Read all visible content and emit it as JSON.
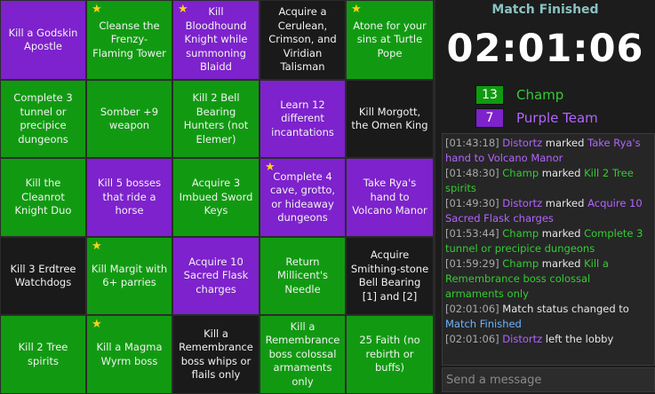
{
  "board": {
    "cells": [
      {
        "text": "Kill a Godskin Apostle",
        "color": "purple",
        "star": false
      },
      {
        "text": "Cleanse the Frenzy-Flaming Tower",
        "color": "green",
        "star": true
      },
      {
        "text": "Kill Bloodhound Knight while summoning Blaidd",
        "color": "purple",
        "star": true
      },
      {
        "text": "Acquire a Cerulean, Crimson, and Viridian Talisman",
        "color": "dark",
        "star": false
      },
      {
        "text": "Atone for your sins at Turtle Pope",
        "color": "green",
        "star": true
      },
      {
        "text": "Complete 3 tunnel or precipice dungeons",
        "color": "green",
        "star": false
      },
      {
        "text": "Somber +9 weapon",
        "color": "green",
        "star": false
      },
      {
        "text": "Kill 2 Bell Bearing Hunters (not Elemer)",
        "color": "green",
        "star": false
      },
      {
        "text": "Learn 12 different incantations",
        "color": "purple",
        "star": false
      },
      {
        "text": "Kill Morgott, the Omen King",
        "color": "dark",
        "star": false
      },
      {
        "text": "Kill the Cleanrot Knight Duo",
        "color": "green",
        "star": false
      },
      {
        "text": "Kill 5 bosses that ride a horse",
        "color": "purple",
        "star": false
      },
      {
        "text": "Acquire 3 Imbued Sword Keys",
        "color": "green",
        "star": false
      },
      {
        "text": "Complete 4 cave, grotto, or hideaway dungeons",
        "color": "purple",
        "star": true
      },
      {
        "text": "Take Rya's hand to Volcano Manor",
        "color": "purple",
        "star": false
      },
      {
        "text": "Kill 3 Erdtree Watchdogs",
        "color": "dark",
        "star": false
      },
      {
        "text": "Kill Margit with 6+ parries",
        "color": "green",
        "star": true
      },
      {
        "text": "Acquire 10 Sacred Flask charges",
        "color": "purple",
        "star": false
      },
      {
        "text": "Return Millicent's Needle",
        "color": "green",
        "star": false
      },
      {
        "text": "Acquire Smithing-stone Bell Bearing [1] and [2]",
        "color": "dark",
        "star": false
      },
      {
        "text": "Kill 2 Tree spirits",
        "color": "green",
        "star": false
      },
      {
        "text": "Kill a Magma Wyrm boss",
        "color": "green",
        "star": true
      },
      {
        "text": "Kill a Remembrance boss whips or flails only",
        "color": "dark",
        "star": false
      },
      {
        "text": "Kill a Remembrance boss colossal armaments only",
        "color": "green",
        "star": false
      },
      {
        "text": "25 Faith (no rebirth or buffs)",
        "color": "green",
        "star": false
      }
    ]
  },
  "colors": {
    "green": "#119a11",
    "purple": "#7d22cc",
    "dark": "#1a1a1a",
    "star": "#ffd21a"
  },
  "status": "Match Finished",
  "timer": "02:01:06",
  "teams": [
    {
      "count": "13",
      "name": "Champ",
      "color": "green"
    },
    {
      "count": "7",
      "name": "Purple Team",
      "color": "purple"
    }
  ],
  "log": [
    [
      {
        "c": "ts",
        "t": "[01:43:18] "
      },
      {
        "c": "p-purple",
        "t": "Distortz"
      },
      {
        "c": "txt",
        "t": " marked "
      },
      {
        "c": "p-purple",
        "t": "Take Rya's hand to Volcano Manor"
      }
    ],
    [
      {
        "c": "ts",
        "t": "[01:48:30] "
      },
      {
        "c": "p-green",
        "t": "Champ"
      },
      {
        "c": "txt",
        "t": " marked "
      },
      {
        "c": "p-green",
        "t": "Kill 2 Tree spirits"
      }
    ],
    [
      {
        "c": "ts",
        "t": "[01:49:30] "
      },
      {
        "c": "p-purple",
        "t": "Distortz"
      },
      {
        "c": "txt",
        "t": " marked "
      },
      {
        "c": "p-purple",
        "t": "Acquire 10 Sacred Flask charges"
      }
    ],
    [
      {
        "c": "ts",
        "t": "[01:53:44] "
      },
      {
        "c": "p-green",
        "t": "Champ"
      },
      {
        "c": "txt",
        "t": " marked "
      },
      {
        "c": "p-green",
        "t": "Complete 3 tunnel or precipice dungeons"
      }
    ],
    [
      {
        "c": "ts",
        "t": "[01:59:29] "
      },
      {
        "c": "p-green",
        "t": "Champ"
      },
      {
        "c": "txt",
        "t": " marked "
      },
      {
        "c": "p-green",
        "t": "Kill a Remembrance boss colossal armaments only"
      }
    ],
    [
      {
        "c": "ts",
        "t": "[02:01:06] "
      },
      {
        "c": "txt",
        "t": "Match status changed to "
      },
      {
        "c": "p-blue",
        "t": "Match Finished"
      }
    ],
    [
      {
        "c": "ts",
        "t": "[02:01:06] "
      },
      {
        "c": "p-purple",
        "t": "Distortz"
      },
      {
        "c": "txt",
        "t": " left the lobby"
      }
    ]
  ],
  "chat": {
    "placeholder": "Send a message"
  }
}
